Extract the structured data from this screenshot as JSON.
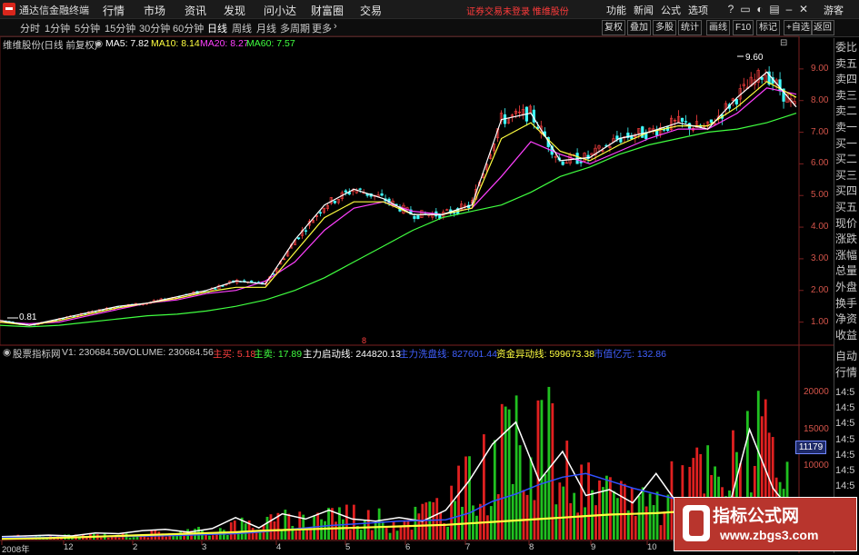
{
  "window": {
    "title": "通达信金融终端",
    "menu": [
      "行情",
      "市场",
      "资讯",
      "发现",
      "问小达",
      "财富圈",
      "交易"
    ],
    "warning": "证券交易未登录 惟维股份",
    "right_menu": [
      "功能",
      "新闻",
      "公式",
      "选项",
      "游客"
    ]
  },
  "toolbar": {
    "periods": [
      "分时",
      "1分钟",
      "5分钟",
      "15分钟",
      "30分钟",
      "60分钟",
      "日线",
      "周线",
      "月线",
      "多周期",
      "更多"
    ],
    "active_period": "日线",
    "buttons": [
      "复权",
      "叠加",
      "多股",
      "统计",
      "画线",
      "F10",
      "标记",
      "+自选",
      "返回"
    ]
  },
  "price_panel": {
    "stock": "维维股份(日线 前复权)",
    "ma": [
      {
        "label": "MA5: 7.82",
        "color": "#ffffff"
      },
      {
        "label": "MA10: 8.14",
        "color": "#ffff40"
      },
      {
        "label": "MA20: 8.27",
        "color": "#ff40ff"
      },
      {
        "label": "MA60: 7.57",
        "color": "#40ff40"
      }
    ],
    "yticks": [
      "9.00",
      "8.00",
      "7.00",
      "6.00",
      "5.00",
      "4.00",
      "3.00",
      "2.00",
      "1.00"
    ],
    "ylim": [
      0.5,
      9.8
    ],
    "high_label": "9.60",
    "low_label": "0.81",
    "mid_marker": "8"
  },
  "volume_panel": {
    "name": "股票指标网",
    "items": [
      {
        "label": "V1: 230684.56",
        "color": "#cfcfcf"
      },
      {
        "label": "VOLUME: 230684.56",
        "color": "#cfcfcf"
      },
      {
        "label": "主买: 5.18",
        "color": "#ff4040"
      },
      {
        "label": "主卖: 17.89",
        "color": "#40ff40"
      },
      {
        "label": "主力启动线: 244820.13",
        "color": "#ffffff"
      },
      {
        "label": "主力洗盘线: 827601.44",
        "color": "#4060ff"
      },
      {
        "label": "资金异动线: 599673.38",
        "color": "#ffff40"
      },
      {
        "label": "市值亿元: 132.86",
        "color": "#4060ff"
      }
    ],
    "yticks": [
      "20000",
      "15000",
      "10000"
    ],
    "badge": "11179"
  },
  "right_panel": {
    "items": [
      "委比",
      "卖五",
      "卖四",
      "卖三",
      "卖二",
      "卖一",
      "买一",
      "买二",
      "买三",
      "买四",
      "买五",
      "现价",
      "涨跌",
      "涨幅",
      "总量",
      "外盘",
      "换手",
      "净资",
      "收益"
    ],
    "items2": [
      "自动",
      "行情"
    ],
    "times": [
      "14:5",
      "14:5",
      "14:5",
      "14:5",
      "14:5",
      "14:5",
      "14:5",
      "14:5",
      "14:5",
      "14:5"
    ]
  },
  "x_axis": [
    "2008年",
    "12",
    "2",
    "3",
    "4",
    "5",
    "6",
    "7",
    "8",
    "9",
    "10"
  ],
  "watermark": {
    "line1": "指标公式网",
    "line2": "www.zbgs3.com"
  },
  "chart_data": [
    {
      "type": "line",
      "title": "维维股份(日线 前复权)",
      "ylim": [
        0.5,
        9.8
      ],
      "series": [
        {
          "name": "MA60",
          "color": "#40ff40",
          "values": [
            0.9,
            0.85,
            0.9,
            1.0,
            1.1,
            1.2,
            1.25,
            1.35,
            1.5,
            1.7,
            2.0,
            2.4,
            2.9,
            3.4,
            3.9,
            4.3,
            4.5,
            4.7,
            5.1,
            5.6,
            5.9,
            6.3,
            6.6,
            6.8,
            7.0,
            7.1,
            7.3,
            7.6
          ]
        },
        {
          "name": "MA20",
          "color": "#ff40ff",
          "values": [
            1.0,
            0.95,
            1.0,
            1.2,
            1.4,
            1.6,
            1.7,
            1.9,
            2.0,
            2.3,
            2.9,
            3.9,
            4.6,
            4.8,
            4.5,
            4.4,
            4.6,
            5.6,
            6.7,
            6.3,
            6.0,
            6.4,
            6.8,
            7.1,
            7.1,
            7.6,
            8.4,
            8.2
          ]
        },
        {
          "name": "MA10",
          "color": "#ffff40",
          "values": [
            1.0,
            0.9,
            1.05,
            1.25,
            1.45,
            1.6,
            1.75,
            1.95,
            2.1,
            2.1,
            3.2,
            4.3,
            4.8,
            4.8,
            4.4,
            4.4,
            4.6,
            6.8,
            7.3,
            6.4,
            6.1,
            6.6,
            7.0,
            7.2,
            7.2,
            7.8,
            8.6,
            8.1
          ]
        },
        {
          "name": "MA5",
          "color": "#ffffff",
          "values": [
            1.05,
            0.9,
            1.1,
            1.3,
            1.5,
            1.6,
            1.8,
            2.0,
            2.3,
            2.2,
            3.6,
            4.7,
            5.2,
            4.9,
            4.4,
            4.4,
            4.7,
            7.4,
            7.6,
            6.1,
            6.2,
            6.8,
            7.0,
            7.3,
            7.1,
            8.1,
            8.9,
            7.8
          ]
        }
      ]
    },
    {
      "type": "bar",
      "title": "股票指标网",
      "ylim": [
        0,
        24000
      ],
      "values": [
        400,
        700,
        500,
        600,
        900,
        800,
        1000,
        1200,
        1400,
        1500,
        2600,
        2800,
        3200,
        4000,
        5000,
        4500,
        3500,
        3400,
        4800,
        6500,
        9800,
        14000,
        16000,
        22000,
        12000,
        9000,
        7000,
        8800,
        6500,
        10000,
        12000,
        9000,
        20000,
        14000,
        6000
      ],
      "series": [
        {
          "name": "主力启动线",
          "color": "#ffffff",
          "values": [
            400,
            500,
            600,
            500,
            900,
            800,
            1200,
            1400,
            1000,
            1500,
            3000,
            1600,
            3500,
            2800,
            4000,
            2800,
            2500,
            3000,
            2500,
            4000,
            8000,
            13000,
            16000,
            8000,
            12000,
            6000,
            6800,
            5000,
            9000,
            4500,
            4500,
            3000,
            15000,
            7000,
            3000
          ]
        },
        {
          "name": "主力洗盘线",
          "color": "#3050ff",
          "values": [
            300,
            300,
            320,
            340,
            380,
            420,
            460,
            520,
            600,
            700,
            800,
            1000,
            1300,
            1600,
            1900,
            2100,
            2300,
            2500,
            2600,
            2700,
            3600,
            5200,
            6200,
            7500,
            8500,
            9000,
            8000,
            7000,
            6200,
            5400,
            4800,
            4500,
            4200,
            4000,
            3900
          ]
        },
        {
          "name": "资金异动线",
          "color": "#ffff40",
          "values": [
            100,
            150,
            200,
            300,
            400,
            500,
            600,
            700,
            800,
            900,
            1000,
            1200,
            1300,
            1400,
            1500,
            1600,
            1700,
            1800,
            1900,
            2000,
            2200,
            2400,
            2600,
            2800,
            3000,
            3200,
            3400,
            3500,
            3600,
            3800,
            3900,
            4000,
            4100,
            4200,
            4300
          ]
        }
      ]
    }
  ]
}
